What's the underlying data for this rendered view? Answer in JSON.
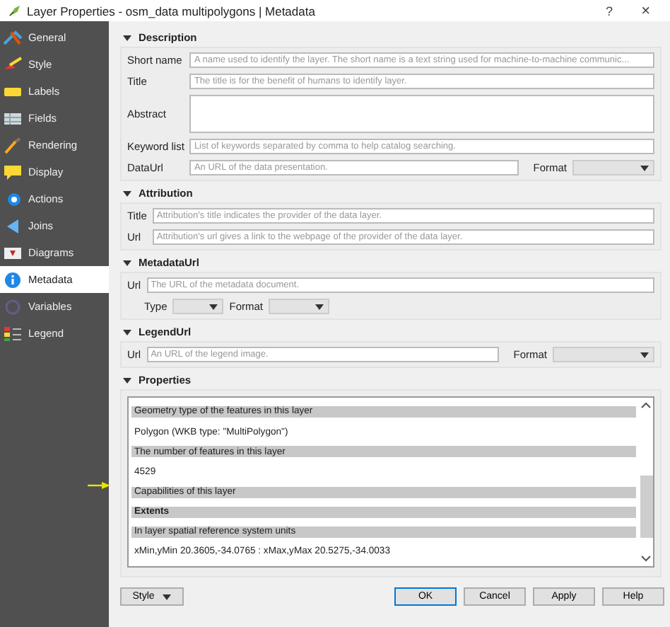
{
  "window": {
    "title": "Layer Properties - osm_data multipolygons | Metadata",
    "help": "?",
    "close": "×"
  },
  "sidebar": {
    "items": [
      {
        "label": "General",
        "selected": false
      },
      {
        "label": "Style",
        "selected": false
      },
      {
        "label": "Labels",
        "selected": false
      },
      {
        "label": "Fields",
        "selected": false
      },
      {
        "label": "Rendering",
        "selected": false
      },
      {
        "label": "Display",
        "selected": false
      },
      {
        "label": "Actions",
        "selected": false
      },
      {
        "label": "Joins",
        "selected": false
      },
      {
        "label": "Diagrams",
        "selected": false
      },
      {
        "label": "Metadata",
        "selected": true
      },
      {
        "label": "Variables",
        "selected": false
      },
      {
        "label": "Legend",
        "selected": false
      }
    ]
  },
  "description": {
    "title": "Description",
    "expanded": true,
    "short_name": {
      "label": "Short name",
      "placeholder": "A name used to identify the layer. The short name is a text string used for machine-to-machine communic..."
    },
    "title_field": {
      "label": "Title",
      "placeholder": "The title is for the benefit of humans to identify layer."
    },
    "abstract": {
      "label": "Abstract"
    },
    "keyword_list": {
      "label": "Keyword list",
      "placeholder": "List of keywords separated by comma to help catalog searching."
    },
    "data_url": {
      "label": "DataUrl",
      "placeholder": "An URL of the data presentation.",
      "format_label": "Format"
    }
  },
  "attribution": {
    "title": "Attribution",
    "expanded": true,
    "title_field": {
      "label": "Title",
      "placeholder": "Attribution's title indicates the provider of the data layer."
    },
    "url": {
      "label": "Url",
      "placeholder": "Attribution's url gives a link to the webpage of the provider of the data layer."
    }
  },
  "metadata_url": {
    "title": "MetadataUrl",
    "expanded": true,
    "url": {
      "label": "Url",
      "placeholder": "The URL of the metadata document."
    },
    "type_label": "Type",
    "format_label": "Format"
  },
  "legend_url": {
    "title": "LegendUrl",
    "expanded": true,
    "url": {
      "label": "Url",
      "placeholder": "An URL of the legend image."
    },
    "format_label": "Format"
  },
  "properties": {
    "title": "Properties",
    "expanded": true,
    "rows": [
      {
        "kind": "header",
        "text": "Geometry type of the features in this layer",
        "bold": false
      },
      {
        "kind": "value",
        "text": "Polygon (WKB type: \"MultiPolygon\")"
      },
      {
        "kind": "header",
        "text": "The number of features in this layer",
        "bold": false
      },
      {
        "kind": "value",
        "text": "4529"
      },
      {
        "kind": "header",
        "text": "Capabilities of this layer",
        "bold": false
      },
      {
        "kind": "header",
        "text": "Extents",
        "bold": true
      },
      {
        "kind": "header",
        "text": "In layer spatial reference system units",
        "bold": false
      },
      {
        "kind": "value",
        "text": "xMin,yMin 20.3605,-34.0765 : xMax,yMax 20.5275,-34.0033"
      }
    ]
  },
  "buttons": {
    "style": "Style",
    "ok": "OK",
    "cancel": "Cancel",
    "apply": "Apply",
    "help": "Help"
  }
}
